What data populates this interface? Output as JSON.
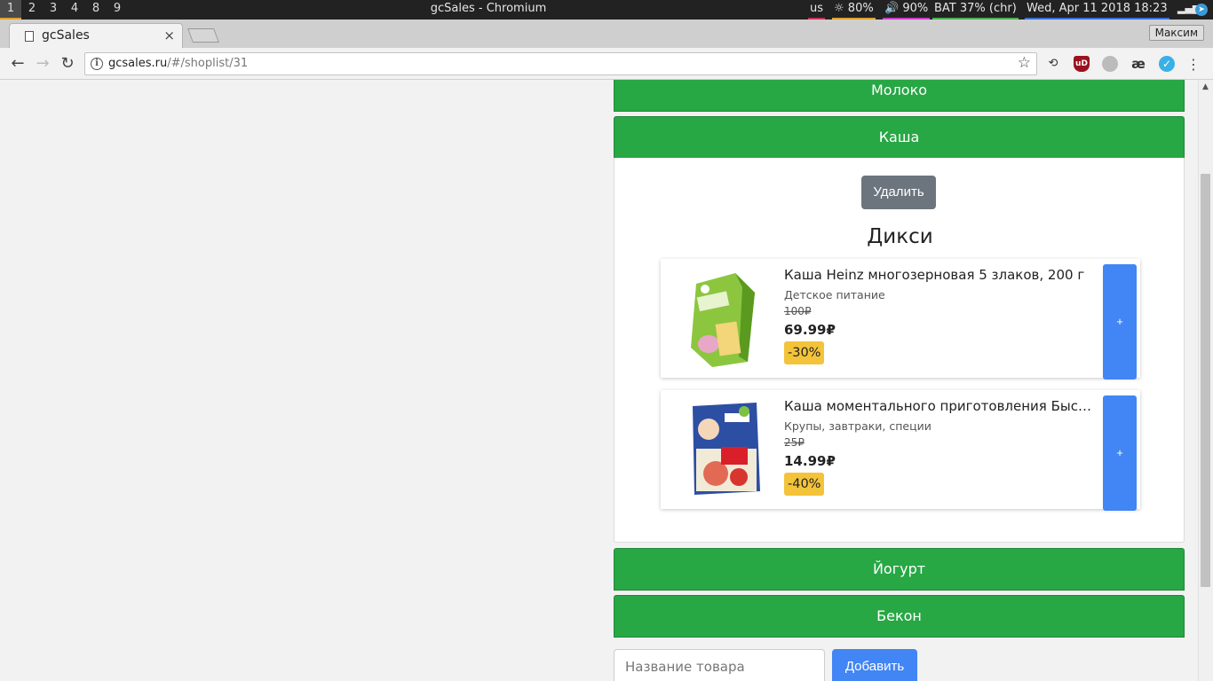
{
  "wm": {
    "workspaces": [
      "1",
      "2",
      "3",
      "4",
      "8",
      "9"
    ],
    "active_workspace": "1",
    "window_title": "gcSales - Chromium",
    "status": {
      "layout": "us",
      "brightness": "80%",
      "volume": "90%",
      "battery": "BAT 37% (chr)",
      "datetime": "Wed, Apr 11 2018 18:23"
    },
    "colors": {
      "brightness_bar": "#e0a030",
      "volume_bar": "#c83cc8",
      "battery_bar": "#4caf50",
      "date_bar": "#3a6fd8"
    }
  },
  "browser": {
    "tab_title": "gcSales",
    "tab_close": "×",
    "profile_name": "Максим",
    "url_host": "gcsales.ru",
    "url_path": "/#/shoplist/31",
    "extensions": [
      "history-icon",
      "ublock-icon",
      "globe-icon",
      "ae-icon",
      "checkmark-icon"
    ],
    "ublock_label": "uD",
    "ae_label": "æ"
  },
  "page": {
    "accent_green": "#28a745",
    "accent_blue": "#4285f4",
    "categories": [
      {
        "label": "Молоко",
        "expanded": false
      },
      {
        "label": "Каша",
        "expanded": true
      },
      {
        "label": "Йогурт",
        "expanded": false
      },
      {
        "label": "Бекон",
        "expanded": false
      }
    ],
    "open_section": {
      "delete_label": "Удалить",
      "store_name": "Дикси",
      "products": [
        {
          "name": "Каша Heinz многозерновая 5 злаков, 200 г",
          "category": "Детское питание",
          "old_price": "100₽",
          "new_price": "69.99₽",
          "discount": "-30%",
          "add_label": "+"
        },
        {
          "name": "Каша моментального приготовления Быстров Ovsyanaya s klubnikoy",
          "name_display": "Каша моментального приготовления Быстров...",
          "category": "Крупы, завтраки, специи",
          "old_price": "25₽",
          "new_price": "14.99₽",
          "discount": "-40%",
          "add_label": "+"
        }
      ]
    },
    "new_item": {
      "placeholder": "Название товара",
      "value": "",
      "submit_label": "Добавить"
    }
  }
}
